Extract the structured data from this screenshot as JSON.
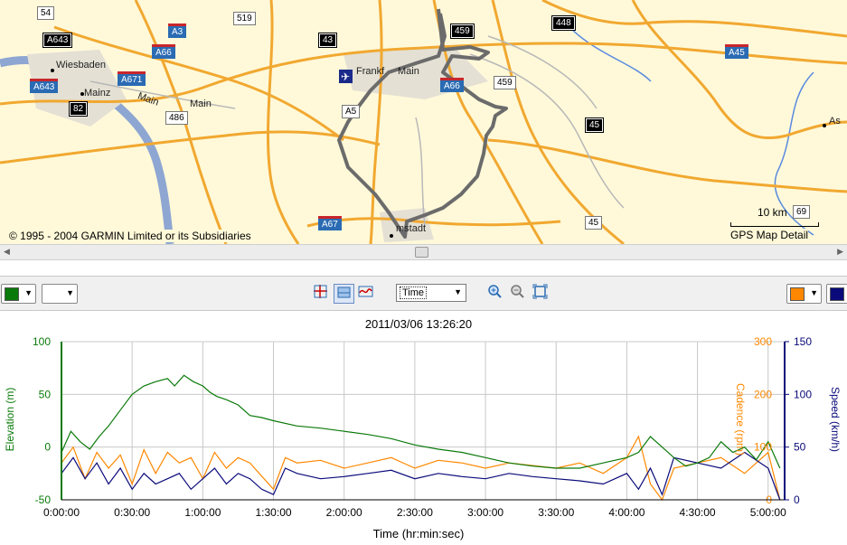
{
  "map": {
    "copyright": "© 1995 - 2004 GARMIN Limited or its Subsidiaries",
    "scale_label": "10 km",
    "detail_label": "GPS Map Detail",
    "places": [
      "Wiesbaden",
      "Mainz",
      "Main",
      "Main",
      "Frankf",
      "Main",
      "mstadt",
      "As"
    ],
    "shields": [
      {
        "text": "54",
        "style": "white"
      },
      {
        "text": "A643",
        "style": "black"
      },
      {
        "text": "A3",
        "style": "blue"
      },
      {
        "text": "A66",
        "style": "blue"
      },
      {
        "text": "519",
        "style": "white"
      },
      {
        "text": "43",
        "style": "black"
      },
      {
        "text": "459",
        "style": "black"
      },
      {
        "text": "448",
        "style": "black"
      },
      {
        "text": "A45",
        "style": "blue"
      },
      {
        "text": "A643",
        "style": "blue"
      },
      {
        "text": "A671",
        "style": "blue"
      },
      {
        "text": "82",
        "style": "black"
      },
      {
        "text": "486",
        "style": "white"
      },
      {
        "text": "A66",
        "style": "blue"
      },
      {
        "text": "459",
        "style": "white"
      },
      {
        "text": "45",
        "style": "black"
      },
      {
        "text": "A67",
        "style": "blue"
      },
      {
        "text": "45",
        "style": "white"
      },
      {
        "text": "69",
        "style": "white"
      },
      {
        "text": "A5",
        "style": "white"
      }
    ]
  },
  "toolbar": {
    "left_color_1": "#0a7a0a",
    "left_color_2": "#ffffff",
    "time_select": "Time",
    "right_color_1": "#ff8800",
    "right_color_2": "#0a0a7a",
    "icons": [
      "crosshair-icon",
      "fill-chart-icon",
      "wave-chart-icon",
      "zoom-in-icon",
      "zoom-out-icon",
      "zoom-fit-icon"
    ]
  },
  "chart_data": {
    "type": "line",
    "title": "2011/03/06 13:26:20",
    "xlabel": "Time (hr:min:sec)",
    "ylabel": "Elevation (m)",
    "y2label": "Cadence (rpm)",
    "y3label": "Speed (km/h)",
    "x_ticks": [
      "0:00:00",
      "0:30:00",
      "1:00:00",
      "1:30:00",
      "2:00:00",
      "2:30:00",
      "3:00:00",
      "3:30:00",
      "4:00:00",
      "4:30:00",
      "5:00:00"
    ],
    "x_range_min": [
      0,
      307
    ],
    "y_ticks": [
      "100",
      "50",
      "0",
      "-50"
    ],
    "y_range": [
      -50,
      100
    ],
    "y2_ticks": [
      "300",
      "200",
      "100",
      "0"
    ],
    "y2_range": [
      0,
      300
    ],
    "y3_ticks": [
      "150",
      "100",
      "50",
      "0"
    ],
    "y3_range": [
      0,
      150
    ],
    "grid": true,
    "colors": {
      "elevation": "#0a7a0a",
      "cadence": "#ff8800",
      "speed": "#0a0a7a"
    },
    "series": [
      {
        "name": "Elevation (m)",
        "x_min": [
          0,
          4,
          8,
          12,
          16,
          20,
          25,
          30,
          35,
          40,
          45,
          48,
          52,
          56,
          60,
          63,
          66,
          70,
          75,
          80,
          85,
          90,
          100,
          110,
          120,
          130,
          140,
          150,
          160,
          170,
          180,
          190,
          200,
          210,
          220,
          230,
          240,
          245,
          250,
          255,
          260,
          265,
          270,
          275,
          280,
          285,
          290,
          295,
          300,
          305
        ],
        "y": [
          -5,
          15,
          5,
          -2,
          10,
          20,
          35,
          50,
          58,
          62,
          65,
          58,
          68,
          62,
          58,
          52,
          48,
          45,
          40,
          30,
          28,
          25,
          20,
          18,
          15,
          12,
          8,
          2,
          -2,
          -5,
          -10,
          -15,
          -18,
          -20,
          -20,
          -15,
          -10,
          -5,
          10,
          0,
          -10,
          -18,
          -15,
          -10,
          5,
          -5,
          0,
          -12,
          5,
          -20
        ]
      },
      {
        "name": "Cadence (rpm)",
        "x_min": [
          0,
          5,
          10,
          15,
          20,
          25,
          30,
          35,
          40,
          45,
          50,
          55,
          60,
          65,
          70,
          75,
          80,
          85,
          90,
          95,
          100,
          110,
          120,
          130,
          140,
          150,
          160,
          170,
          180,
          190,
          200,
          210,
          220,
          230,
          240,
          245,
          250,
          255,
          260,
          270,
          280,
          290,
          300,
          305
        ],
        "y": [
          70,
          100,
          40,
          90,
          60,
          85,
          30,
          95,
          50,
          90,
          70,
          80,
          40,
          90,
          60,
          80,
          70,
          45,
          20,
          80,
          70,
          75,
          60,
          70,
          80,
          60,
          75,
          70,
          60,
          70,
          65,
          60,
          70,
          50,
          80,
          120,
          30,
          0,
          60,
          70,
          80,
          50,
          90,
          0
        ]
      },
      {
        "name": "Speed (km/h)",
        "x_min": [
          0,
          5,
          10,
          15,
          20,
          25,
          30,
          35,
          40,
          45,
          50,
          55,
          60,
          65,
          70,
          75,
          80,
          85,
          90,
          95,
          100,
          110,
          120,
          130,
          140,
          150,
          160,
          170,
          180,
          190,
          200,
          210,
          220,
          230,
          240,
          245,
          250,
          255,
          260,
          270,
          280,
          290,
          300,
          305
        ],
        "y": [
          25,
          40,
          20,
          35,
          15,
          30,
          10,
          25,
          15,
          20,
          25,
          10,
          20,
          30,
          15,
          25,
          20,
          10,
          5,
          30,
          25,
          20,
          22,
          25,
          28,
          20,
          25,
          22,
          20,
          25,
          22,
          20,
          18,
          15,
          25,
          10,
          30,
          5,
          40,
          35,
          30,
          45,
          30,
          0
        ]
      }
    ]
  }
}
